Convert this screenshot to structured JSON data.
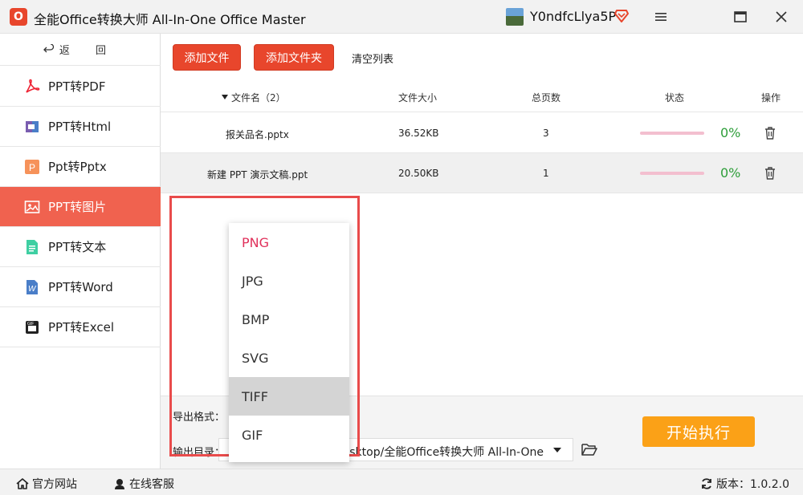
{
  "titlebar": {
    "logo_text": "O",
    "app_title": "全能Office转换大师 All-In-One Office Master",
    "username": "Y0ndfcLlya5P",
    "icons": [
      "avatar",
      "vip-diamond-icon",
      "menu-icon",
      "maximize-icon",
      "close-icon"
    ]
  },
  "sidebar": {
    "back_label": "返 回",
    "items": [
      {
        "label": "PPT转PDF",
        "icon": "pdf-icon",
        "active": false
      },
      {
        "label": "PPT转Html",
        "icon": "html-icon",
        "active": false
      },
      {
        "label": "Ppt转Pptx",
        "icon": "pptx-icon",
        "active": false
      },
      {
        "label": "PPT转图片",
        "icon": "image-icon",
        "active": true
      },
      {
        "label": "PPT转文本",
        "icon": "text-icon",
        "active": false
      },
      {
        "label": "PPT转Word",
        "icon": "word-icon",
        "active": false
      },
      {
        "label": "PPT转Excel",
        "icon": "excel-icon",
        "active": false
      }
    ]
  },
  "toolbar": {
    "add_file": "添加文件",
    "add_folder": "添加文件夹",
    "clear_list": "清空列表"
  },
  "table": {
    "headers": {
      "name": "文件名（2）",
      "size": "文件大小",
      "pages": "总页数",
      "status": "状态",
      "action": "操作"
    },
    "rows": [
      {
        "name": "报关品名.pptx",
        "size": "36.52KB",
        "pages": "3",
        "progress": "0%"
      },
      {
        "name": "新建 PPT 演示文稿.ppt",
        "size": "20.50KB",
        "pages": "1",
        "progress": "0%"
      }
    ]
  },
  "bottom": {
    "export_format_label": "导出格式：",
    "output_dir_label": "输出目录：",
    "output_dir_value": "esktop/全能Office转换大师 All-In-One",
    "start_button": "开始执行"
  },
  "format_dropdown": {
    "options": [
      "PNG",
      "JPG",
      "BMP",
      "SVG",
      "TIFF",
      "GIF"
    ],
    "selected": "PNG",
    "hovered": "TIFF"
  },
  "statusbar": {
    "website": "官方网站",
    "support": "在线客服",
    "version": "版本：1.0.2.0"
  },
  "colors": {
    "brand_red": "#e8462c",
    "active_nav": "#f0624f",
    "start_orange": "#fba117",
    "progress_green": "#2e9e3a",
    "selected_pink": "#e0305a"
  }
}
